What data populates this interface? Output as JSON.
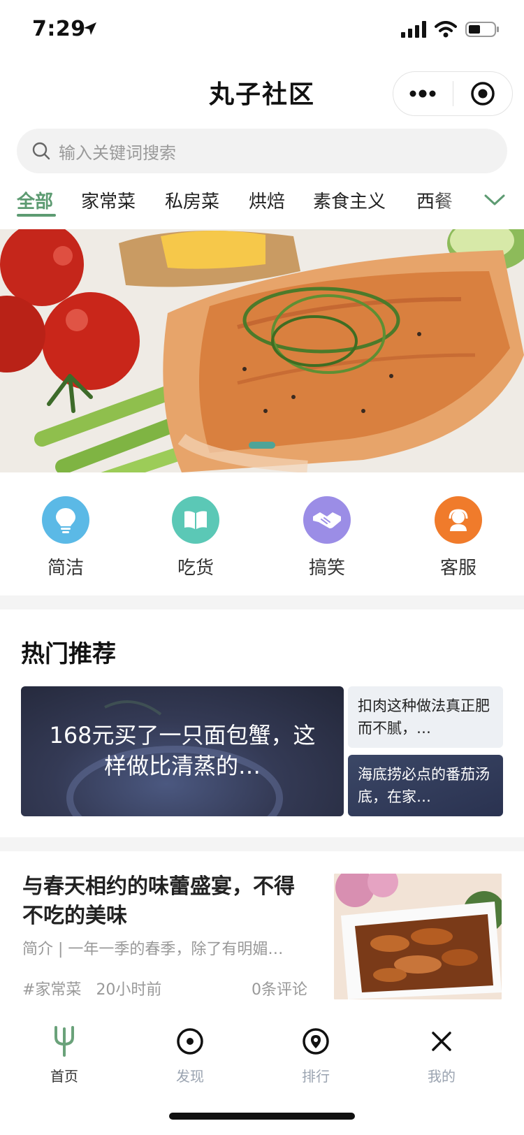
{
  "status": {
    "time": "7:29"
  },
  "nav": {
    "title": "丸子社区"
  },
  "search": {
    "placeholder": "输入关键词搜索"
  },
  "tabs": [
    {
      "label": "全部",
      "active": true
    },
    {
      "label": "家常菜"
    },
    {
      "label": "私房菜"
    },
    {
      "label": "烘焙"
    },
    {
      "label": "素食主义"
    },
    {
      "label": "西餐"
    }
  ],
  "quick_icons": [
    {
      "label": "简洁",
      "icon": "lightbulb-icon",
      "color": "#5bb9e6"
    },
    {
      "label": "吃货",
      "icon": "book-icon",
      "color": "#5bc8b6"
    },
    {
      "label": "搞笑",
      "icon": "handshake-icon",
      "color": "#9b8de6"
    },
    {
      "label": "客服",
      "icon": "support-agent-icon",
      "color": "#f07b2b"
    }
  ],
  "hot": {
    "title": "热门推荐",
    "main": "168元买了一只面包蟹，这样做比清蒸的…",
    "side": [
      "扣肉这种做法真正肥而不腻，…",
      "海底捞必点的番茄汤底，在家…"
    ]
  },
  "article": {
    "title": "与春天相约的味蕾盛宴，不得不吃的美味",
    "desc": "简介 | 一年一季的春季，除了有明媚…",
    "tag": "#家常菜",
    "time": "20小时前",
    "comments": "0条评论"
  },
  "tabbar": [
    {
      "label": "首页",
      "icon": "fork-icon",
      "active": true
    },
    {
      "label": "发现",
      "icon": "discover-icon"
    },
    {
      "label": "排行",
      "icon": "location-pin-icon"
    },
    {
      "label": "我的",
      "icon": "close-icon"
    }
  ],
  "colors": {
    "accent": "#5d9b72",
    "banner_dot": "#4ea497"
  }
}
